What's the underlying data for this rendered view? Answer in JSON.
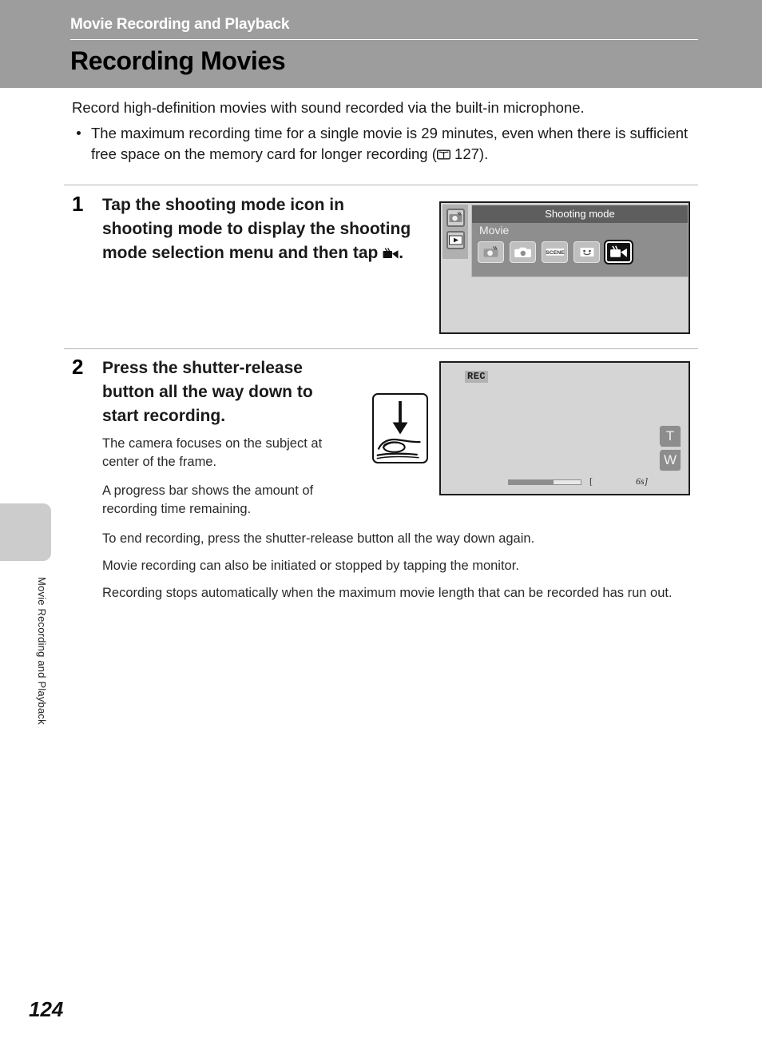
{
  "header": {
    "chapter_title": "Movie Recording and Playback",
    "section_title": "Recording Movies"
  },
  "side_tab": {
    "label": "Movie Recording and Playback"
  },
  "intro": {
    "lead": "Record high-definition movies with sound recorded via the built-in microphone.",
    "bullet_part1": "The maximum recording time for a single movie is 29 minutes, even when there is sufficient free space on the memory card for longer recording (",
    "bullet_ref": "127",
    "bullet_part2": ")."
  },
  "steps": [
    {
      "number": "1",
      "heading_part1": "Tap the shooting mode icon in shooting mode to display the shooting mode selection menu and then tap ",
      "heading_part2": "."
    },
    {
      "number": "2",
      "heading": "Press the shutter-release button all the way down to start recording.",
      "notes": [
        "The camera focuses on the subject at center of the frame.",
        "A progress bar shows the amount of recording time remaining.",
        "To end recording, press the shutter-release button all the way down again.",
        "Movie recording can also be initiated or stopped by tapping the monitor.",
        "Recording stops automatically when the maximum movie length that can be recorded has run out."
      ]
    }
  ],
  "screen1": {
    "menu_title": "Shooting mode",
    "mode_label": "Movie",
    "side_buttons": [
      "shooting-mode-icon",
      "playback-icon"
    ],
    "mode_options": [
      {
        "name": "auto-scene-selector-icon",
        "selected": false
      },
      {
        "name": "auto-mode-icon",
        "selected": false
      },
      {
        "name": "scene-mode-icon",
        "label": "SCENE",
        "selected": false
      },
      {
        "name": "smart-portrait-icon",
        "selected": false
      },
      {
        "name": "movie-mode-icon",
        "selected": true
      }
    ]
  },
  "screen2": {
    "rec_indicator": "REC",
    "zoom_tele": "T",
    "zoom_wide": "W",
    "progress_percent": 62,
    "bracket_left": "[",
    "time_remaining": "6s",
    "bracket_right": "]"
  },
  "footer": {
    "page_number": "124"
  },
  "colors": {
    "header_band": "#9d9d9d",
    "screen_bg": "#d5d5d5",
    "menu_panel": "#8e8e8e",
    "menu_titlebar": "#5e5e5e",
    "rule": "#b4b4b4",
    "edge_tab": "#cccccc"
  }
}
